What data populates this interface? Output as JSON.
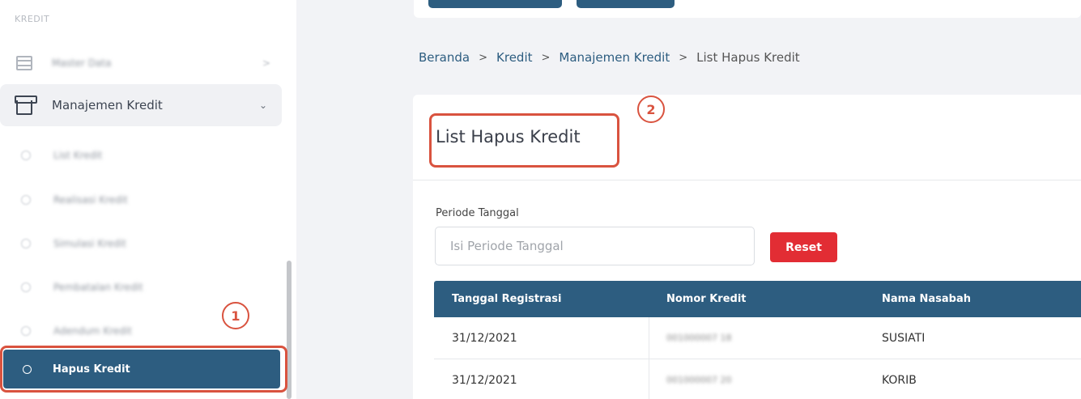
{
  "sidebar": {
    "section_title": "KREDIT",
    "master_data_label": "Master Data",
    "manajemen_label": "Manajemen Kredit",
    "sub_items": [
      {
        "label": "List Kredit"
      },
      {
        "label": "Realisasi Kredit"
      },
      {
        "label": "Simulasi Kredit"
      },
      {
        "label": "Pembatalan Kredit"
      },
      {
        "label": "Adendum Kredit"
      }
    ],
    "active_label": "Hapus Kredit"
  },
  "breadcrumb": {
    "items": [
      "Beranda",
      "Kredit",
      "Manajemen Kredit"
    ],
    "current": "List Hapus Kredit",
    "separator": ">"
  },
  "card": {
    "title": "List Hapus Kredit",
    "filter_label": "Periode Tanggal",
    "filter_placeholder": "Isi Periode Tanggal",
    "reset_label": "Reset"
  },
  "table": {
    "headers": [
      "Tanggal Registrasi",
      "Nomor Kredit",
      "Nama Nasabah"
    ],
    "rows": [
      {
        "tanggal": "31/12/2021",
        "nomor": "001000007 18",
        "nama": "SUSIATI"
      },
      {
        "tanggal": "31/12/2021",
        "nomor": "001000007 20",
        "nama": "KORIB"
      }
    ]
  },
  "annotations": [
    "1",
    "2"
  ],
  "colors": {
    "primary": "#2d5d80",
    "danger": "#e22d34",
    "annotation": "#d9533f"
  }
}
